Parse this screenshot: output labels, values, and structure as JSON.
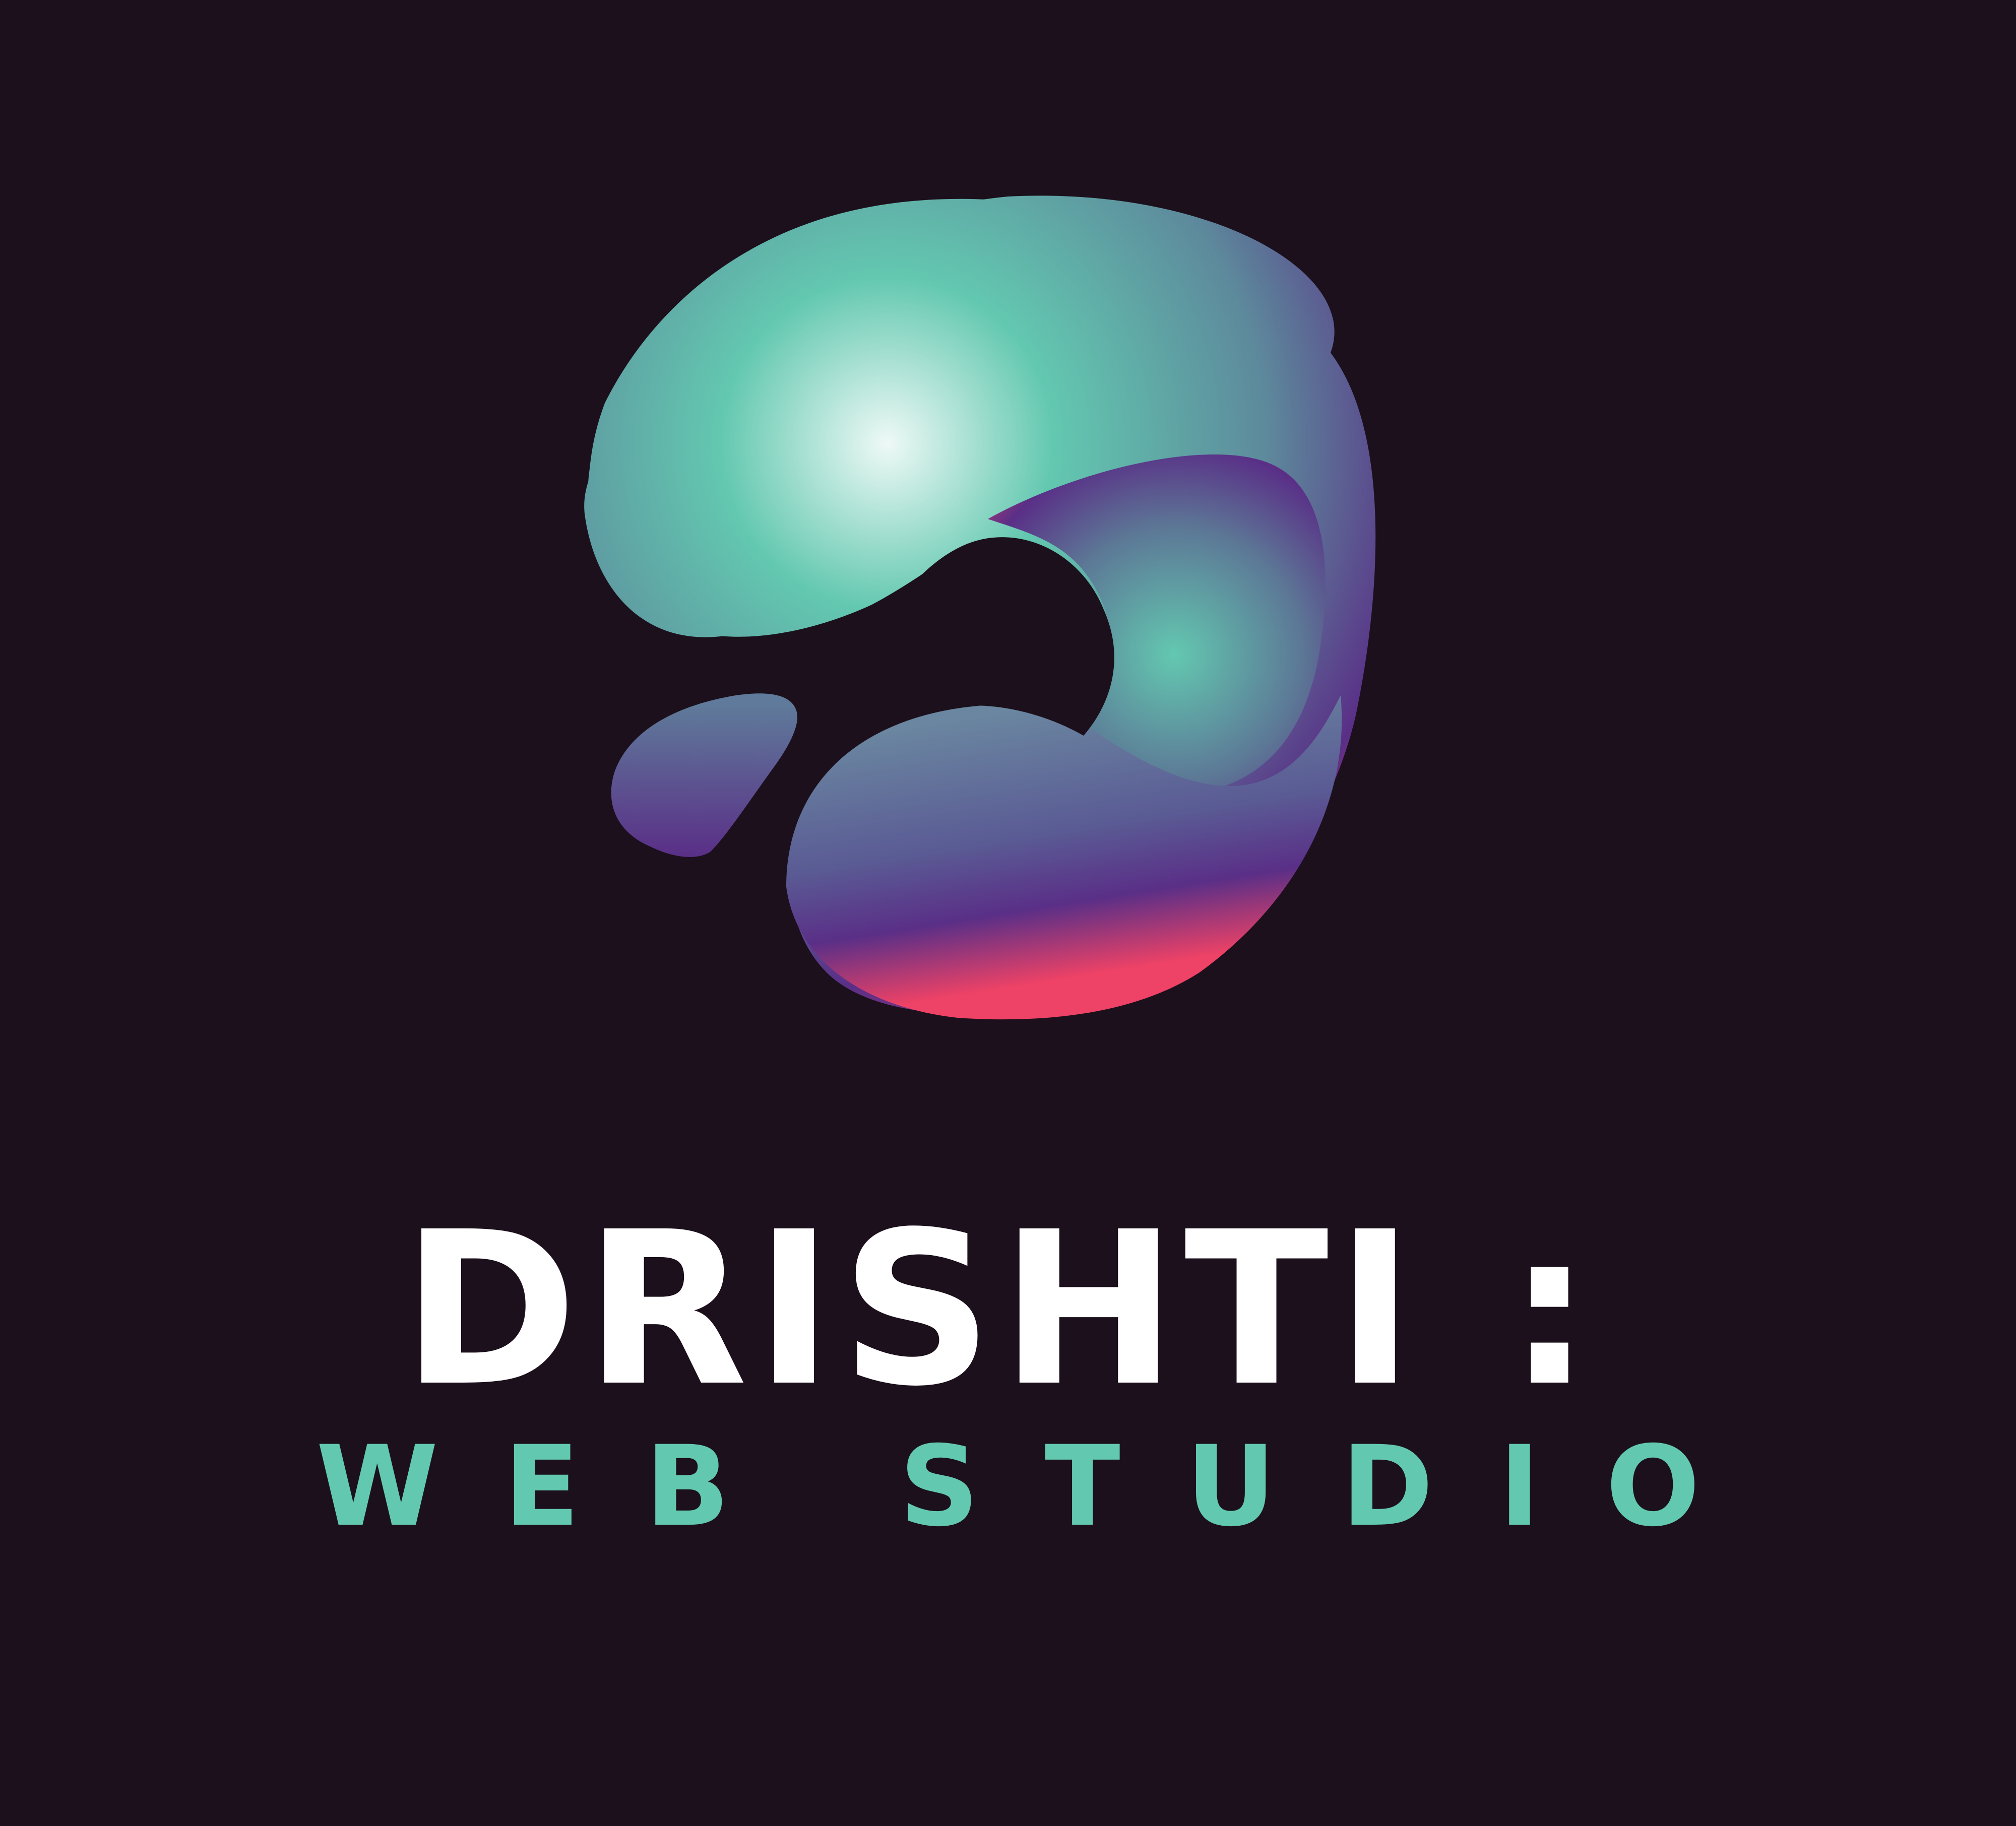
{
  "logo": {
    "icon": "gradient-swirl-logo-icon",
    "colors": {
      "background": "#1b101b",
      "teal": "#63c8b0",
      "teal_light": "#e4f6f2",
      "purple": "#5a2f87",
      "slate": "#5c7896",
      "pink": "#ee4266"
    }
  },
  "brand": {
    "name": "DRISHTI",
    "separator": ":",
    "tagline": "WEB STUDIO",
    "name_color": "#ffffff",
    "tagline_color": "#63c8b0"
  }
}
